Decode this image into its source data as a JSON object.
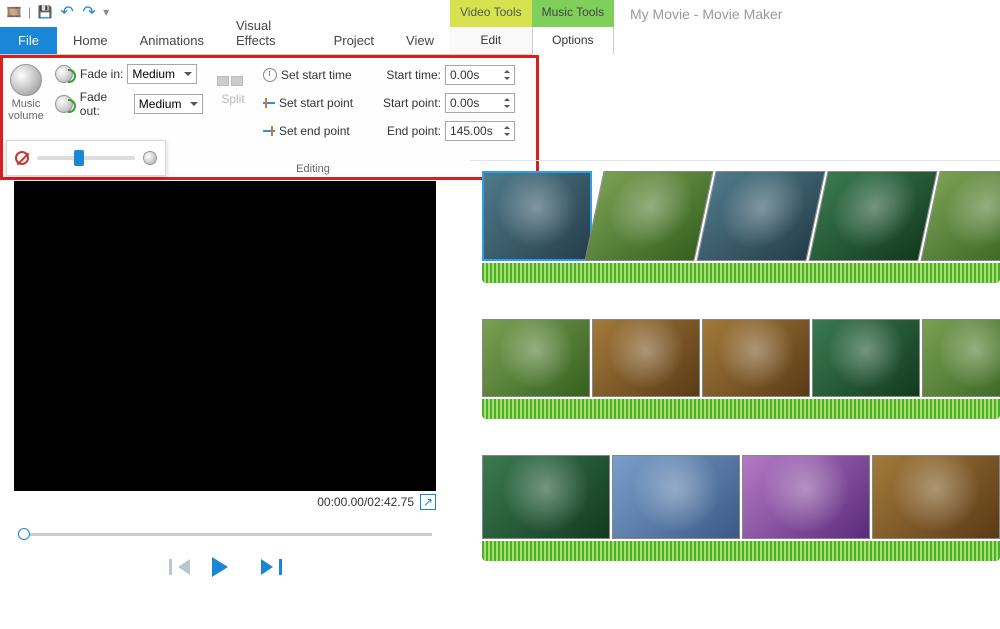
{
  "qat": {
    "undo": "↶",
    "redo": "↷"
  },
  "window": {
    "title": "My Movie - Movie Maker"
  },
  "tool_tabs": {
    "video": {
      "label": "Video Tools",
      "sub": "Edit"
    },
    "music": {
      "label": "Music Tools",
      "sub": "Options"
    }
  },
  "menu": {
    "file": "File",
    "tabs": [
      "Home",
      "Animations",
      "Visual Effects",
      "Project",
      "View"
    ]
  },
  "ribbon": {
    "music_volume": "Music\nvolume",
    "fade_in_label": "Fade in:",
    "fade_out_label": "Fade out:",
    "fade_in_value": "Medium",
    "fade_out_value": "Medium",
    "split": "Split",
    "set_start_time": "Set start time",
    "set_start_point": "Set start point",
    "set_end_point": "Set end point",
    "start_time_label": "Start time:",
    "start_point_label": "Start point:",
    "end_point_label": "End point:",
    "start_time_value": "0.00s",
    "start_point_value": "0.00s",
    "end_point_value": "145.00s",
    "editing_label": "Editing"
  },
  "preview": {
    "time": "00:00.00/02:42.75"
  }
}
